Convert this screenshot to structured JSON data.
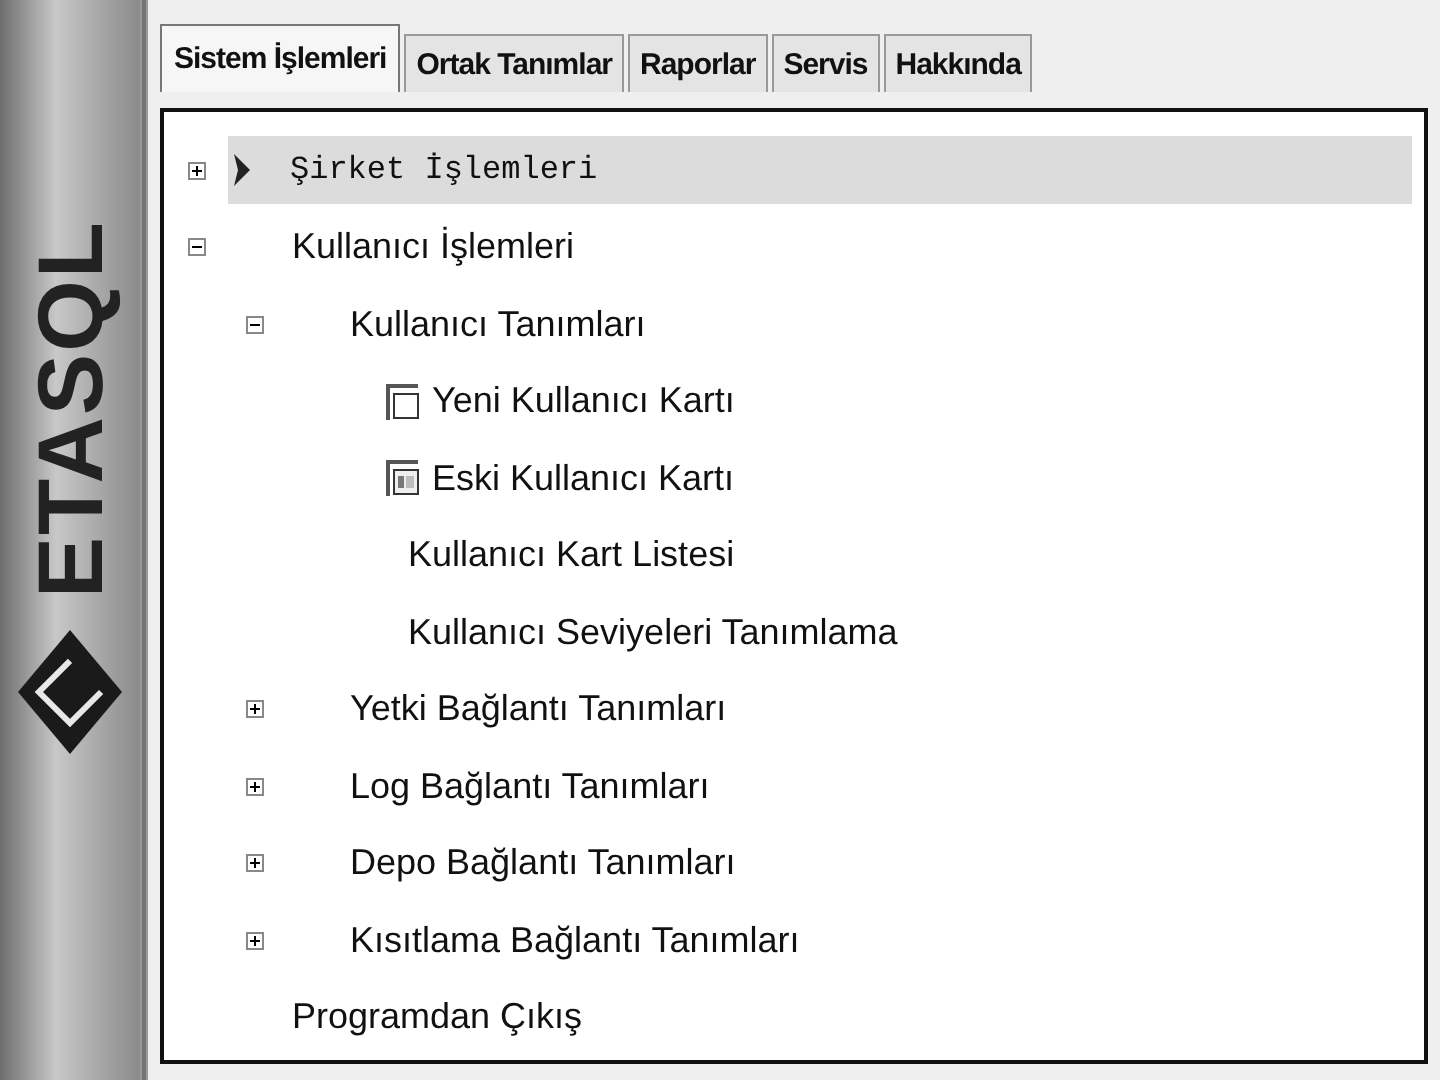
{
  "logo": {
    "text": "ETASQL"
  },
  "tabs": [
    {
      "label": "Sistem İşlemleri",
      "selected": true
    },
    {
      "label": "Ortak Tanımlar",
      "selected": false
    },
    {
      "label": "Raporlar",
      "selected": false
    },
    {
      "label": "Servis",
      "selected": false
    },
    {
      "label": "Hakkında",
      "selected": false
    }
  ],
  "tree": [
    {
      "label": "Şirket İşlemleri",
      "kind": "arrow",
      "selected": true,
      "expanded": false
    },
    {
      "label": "Kullanıcı İşlemleri",
      "selected": false,
      "expanded": true,
      "children": [
        {
          "label": "Kullanıcı Tanımları",
          "selected": false,
          "expanded": true,
          "children": [
            {
              "label": "Yeni Kullanıcı Kartı",
              "kind": "window",
              "selected": false
            },
            {
              "label": "Eski Kullanıcı Kartı",
              "kind": "list-window",
              "selected": false
            },
            {
              "label": "Kullanıcı Kart Listesi",
              "selected": false
            },
            {
              "label": "Kullanıcı Seviyeleri Tanımlama",
              "selected": false
            }
          ]
        },
        {
          "label": "Yetki Bağlantı Tanımları",
          "selected": false,
          "expanded": false
        },
        {
          "label": "Log Bağlantı Tanımları",
          "selected": false,
          "expanded": false
        },
        {
          "label": "Depo Bağlantı Tanımları",
          "selected": false,
          "expanded": false
        },
        {
          "label": "Kısıtlama Bağlantı Tanımları",
          "selected": false,
          "expanded": false
        }
      ]
    },
    {
      "label": "Programdan Çıkış",
      "selected": false
    }
  ]
}
